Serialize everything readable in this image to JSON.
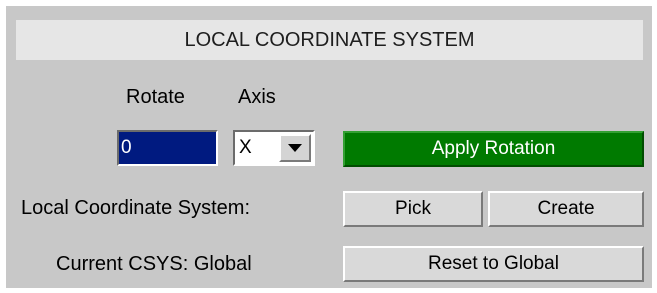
{
  "panel": {
    "title": "LOCAL COORDINATE SYSTEM"
  },
  "headers": {
    "rotate": "Rotate",
    "axis": "Axis"
  },
  "rotation": {
    "value": "0",
    "axis_value": "X",
    "axis_dropdown_icon": "triangle-down-icon",
    "apply_label": "Apply Rotation",
    "apply_color": "#007a00",
    "value_field_color": "#001a80"
  },
  "local_csys": {
    "label": "Local Coordinate System:",
    "pick_label": "Pick",
    "create_label": "Create"
  },
  "current_csys": {
    "label": "Current CSYS: Global",
    "reset_label": "Reset to Global"
  }
}
